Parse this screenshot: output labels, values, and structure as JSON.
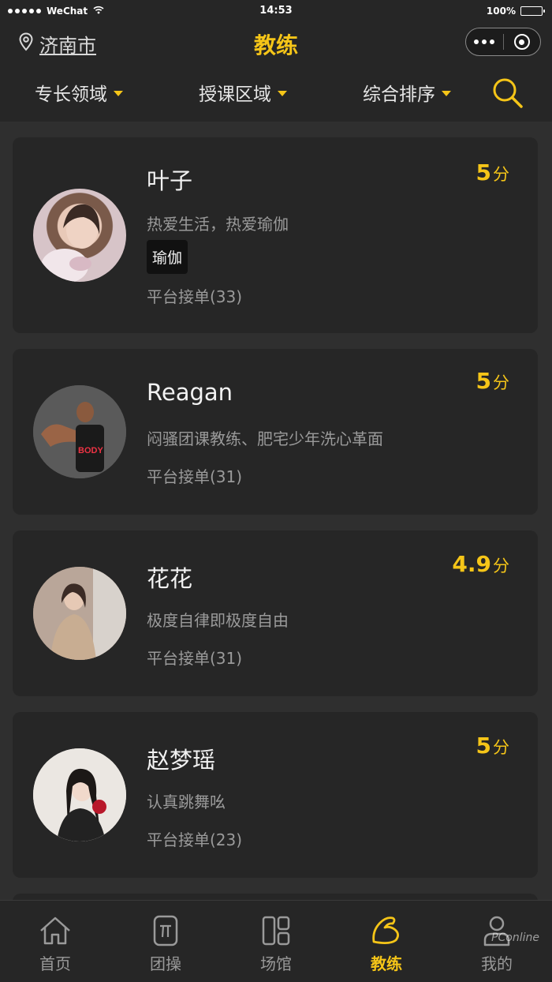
{
  "status_bar": {
    "carrier": "WeChat",
    "time": "14:53",
    "battery": "100%"
  },
  "nav": {
    "city": "济南市",
    "title": "教练"
  },
  "filters": {
    "specialty": "专长领域",
    "area": "授课区域",
    "sort": "综合排序"
  },
  "coaches": [
    {
      "name": "叶子",
      "score": "5",
      "unit": "分",
      "motto": "热爱生活，热爱瑜伽",
      "tag": "瑜伽",
      "orders": "平台接单(33)"
    },
    {
      "name": "Reagan",
      "score": "5",
      "unit": "分",
      "motto": "闷骚团课教练、肥宅少年洗心革面",
      "orders": "平台接单(31)"
    },
    {
      "name": "花花",
      "score": "4.9",
      "unit": "分",
      "motto": "极度自律即极度自由",
      "orders": "平台接单(31)"
    },
    {
      "name": "赵梦瑶",
      "score": "5",
      "unit": "分",
      "motto": "认真跳舞吆",
      "orders": "平台接单(23)"
    }
  ],
  "tabs": [
    {
      "label": "首页",
      "icon": "home-icon"
    },
    {
      "label": "团操",
      "icon": "group-class-icon"
    },
    {
      "label": "场馆",
      "icon": "venue-icon"
    },
    {
      "label": "教练",
      "icon": "coach-arm-icon"
    },
    {
      "label": "我的",
      "icon": "user-icon"
    }
  ],
  "watermark": "PConline",
  "colors": {
    "accent": "#f5c518",
    "background": "#2f2f2f",
    "card": "#262626"
  }
}
